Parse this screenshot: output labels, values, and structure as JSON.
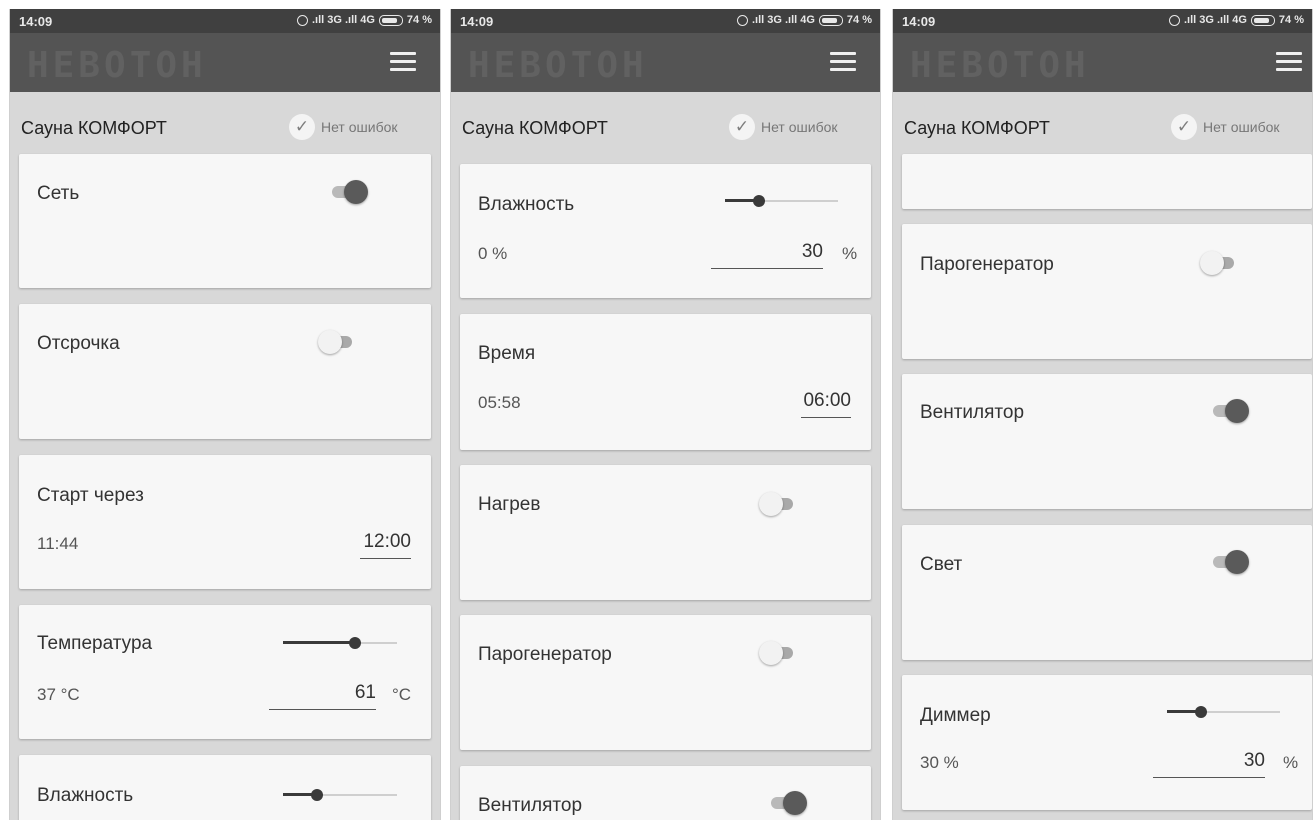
{
  "status_bar": {
    "time": "14:09",
    "network": ".ıll 3G .ıll 4G",
    "battery": "74 %"
  },
  "app": {
    "logo": "НЕВОТОН"
  },
  "header": {
    "device_name": "Сауна КОМФОРТ",
    "status_text": "Нет ошибок",
    "status_icon": "check-icon"
  },
  "colors": {
    "appbar": "#545454",
    "statusbar": "#404040",
    "background": "#d8d8d8",
    "card": "#f7f7f7",
    "switch_on": "#5a5a5a"
  },
  "screen1": {
    "network": {
      "label": "Сеть",
      "on": true
    },
    "delay": {
      "label": "Отсрочка",
      "on": false
    },
    "start_after": {
      "label": "Старт через",
      "current": "11:44",
      "set": "12:00"
    },
    "temperature": {
      "label": "Температура",
      "current": "37 °C",
      "set": "61",
      "unit": "°C",
      "level": 0.63
    },
    "humidity": {
      "label": "Влажность",
      "level": 0.3
    }
  },
  "screen2": {
    "humidity": {
      "label": "Влажность",
      "current": "0 %",
      "set": "30",
      "unit": "%",
      "level": 0.3
    },
    "time": {
      "label": "Время",
      "current": "05:58",
      "set": "06:00"
    },
    "heating": {
      "label": "Нагрев",
      "on": false
    },
    "steam_generator": {
      "label": "Парогенератор",
      "on": false
    },
    "fan": {
      "label": "Вентилятор",
      "on": true
    }
  },
  "screen3": {
    "steam_generator": {
      "label": "Парогенератор",
      "on": false
    },
    "fan": {
      "label": "Вентилятор",
      "on": true
    },
    "light": {
      "label": "Свет",
      "on": true
    },
    "dimmer": {
      "label": "Диммер",
      "current": "30 %",
      "set": "30",
      "unit": "%",
      "level": 0.3
    }
  }
}
